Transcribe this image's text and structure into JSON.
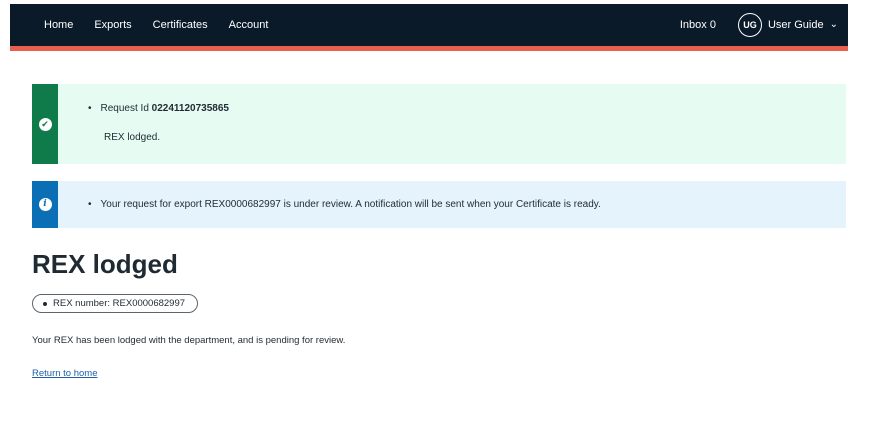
{
  "nav": {
    "items": [
      "Home",
      "Exports",
      "Certificates",
      "Account"
    ],
    "inbox_label": "Inbox 0",
    "avatar_initials": "UG",
    "user_name": "User Guide"
  },
  "success_alert": {
    "request_label": "Request Id",
    "request_id": "02241120735865",
    "message": "REX lodged."
  },
  "info_alert": {
    "message": "Your request for export REX0000682997 is under review. A notification will be sent when your Certificate is ready."
  },
  "page": {
    "title": "REX lodged",
    "tag": "REX number: REX0000682997",
    "description": "Your REX has been lodged with the department, and is pending for review.",
    "return_link": "Return to home"
  },
  "colors": {
    "header_bg": "#0b1a29",
    "accent": "#e85f4e",
    "success": "#0f7a4a",
    "info": "#0b6fb6"
  },
  "icons": {
    "success": "check-circle-icon",
    "info": "info-circle-icon",
    "user_menu": "chevron-down-icon"
  }
}
